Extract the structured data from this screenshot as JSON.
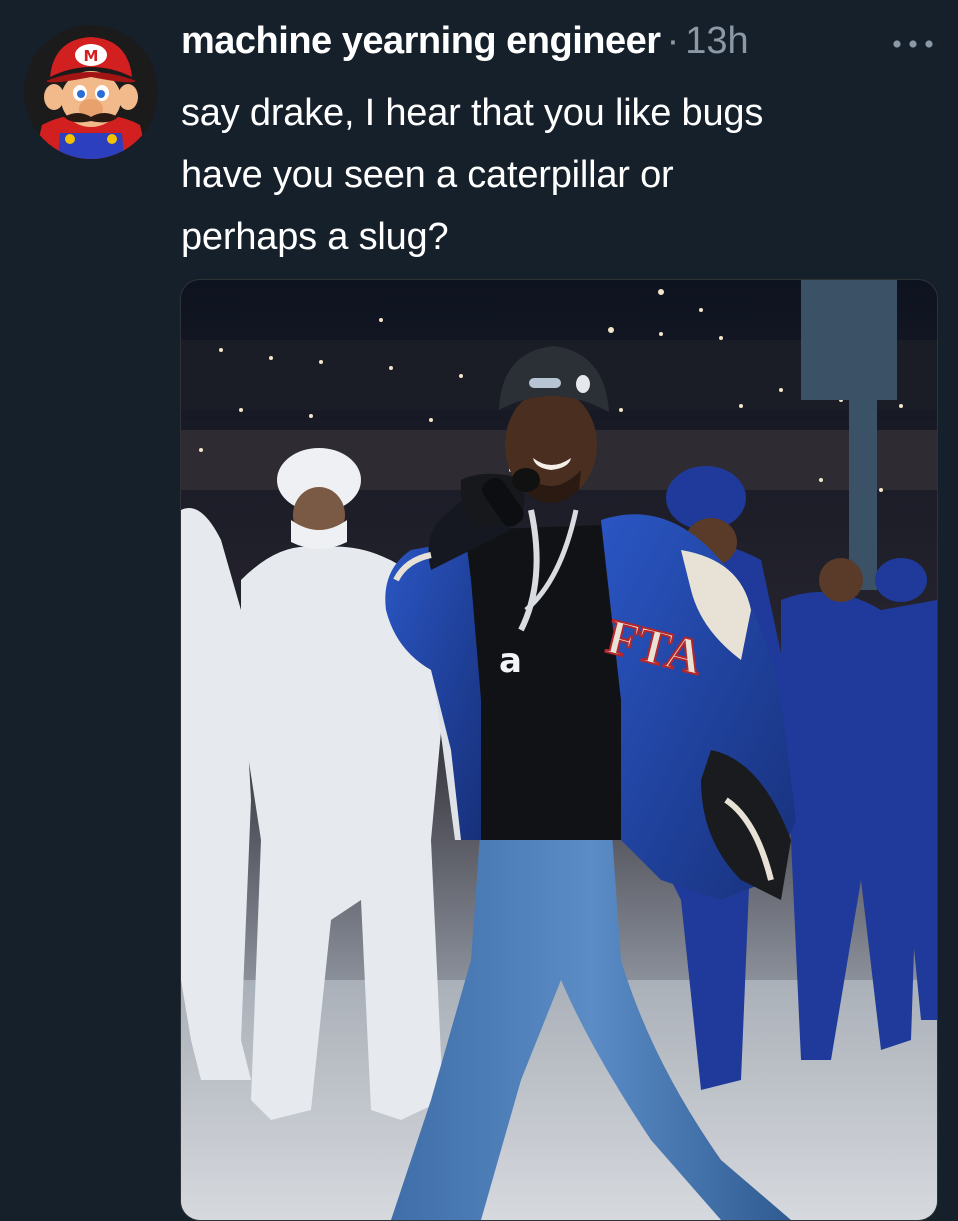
{
  "tweet": {
    "author": {
      "display_name": "machine yearning engineer",
      "avatar_icon": "mario-avatar-icon"
    },
    "separator": "·",
    "timestamp": "13h",
    "more_icon": "more-horizontal-icon",
    "text_lines": [
      "say drake, I hear that you like bugs",
      "have you seen a caterpillar or",
      "perhaps a slug?"
    ],
    "media": {
      "type": "photo",
      "jacket_text": "FTA",
      "pendant_text": "a"
    }
  },
  "colors": {
    "background": "#15202b",
    "text_primary": "#ffffff",
    "text_secondary": "#8b98a5"
  }
}
